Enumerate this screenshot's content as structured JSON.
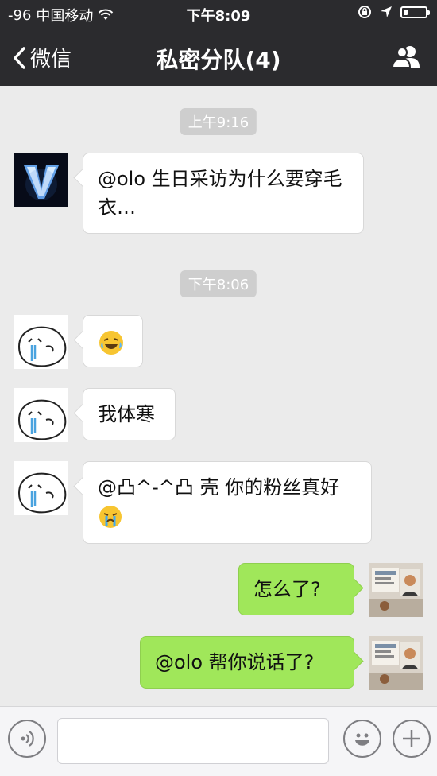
{
  "status_bar": {
    "signal": "-96",
    "carrier": "中国移动",
    "time": "下午8:09"
  },
  "nav": {
    "back_label": "微信",
    "title": "私密分队(4)"
  },
  "messages": {
    "ts1": "上午9:16",
    "m1": "@olo 生日采访为什么要穿毛衣…",
    "ts2": "下午8:06",
    "m3": "我体寒",
    "m4": "@凸^-^凸 壳 你的粉丝真好",
    "m5": "怎么了?",
    "m6": "@olo 帮你说话了?"
  },
  "colors": {
    "bar_bg": "#2b2b2e",
    "chat_bg": "#ebebeb",
    "sent_bubble": "#a0e75a",
    "received_bubble": "#ffffff",
    "timestamp_bg": "#cecece"
  },
  "icons": {
    "status": [
      "wifi-icon",
      "rotation-lock-icon",
      "location-arrow-icon",
      "battery-icon"
    ],
    "nav": [
      "back-chevron-icon",
      "group-members-icon"
    ],
    "input": [
      "voice-icon",
      "emoji-icon",
      "plus-icon"
    ]
  }
}
